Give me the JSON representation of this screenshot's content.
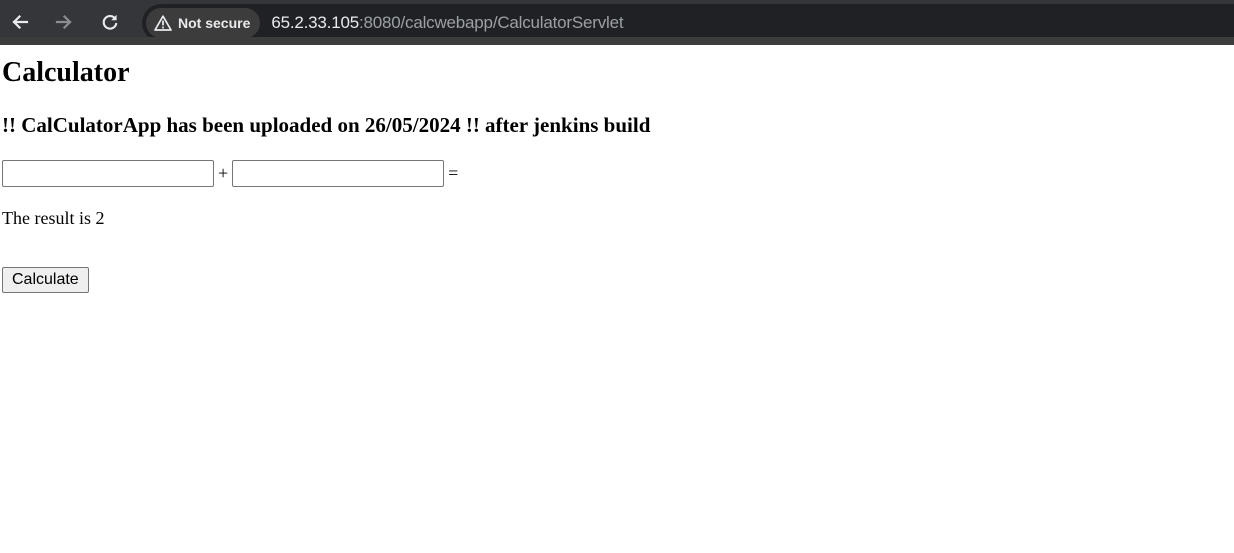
{
  "browser": {
    "security_label": "Not secure",
    "url_host": "65.2.33.105",
    "url_rest": ":8080/calcwebapp/CalculatorServlet",
    "icons": {
      "back": "back-arrow-icon",
      "forward": "forward-arrow-icon",
      "reload": "reload-icon",
      "security": "warning-triangle-icon"
    }
  },
  "page": {
    "title": "Calculator",
    "subtitle": "!! CalCulatorApp has been uploaded on 26/05/2024 !! after jenkins build",
    "form": {
      "input1_value": "",
      "input2_value": "",
      "plus_sign": "+",
      "equals_sign": "="
    },
    "result_text": "The result is 2",
    "calculate_label": "Calculate"
  }
}
